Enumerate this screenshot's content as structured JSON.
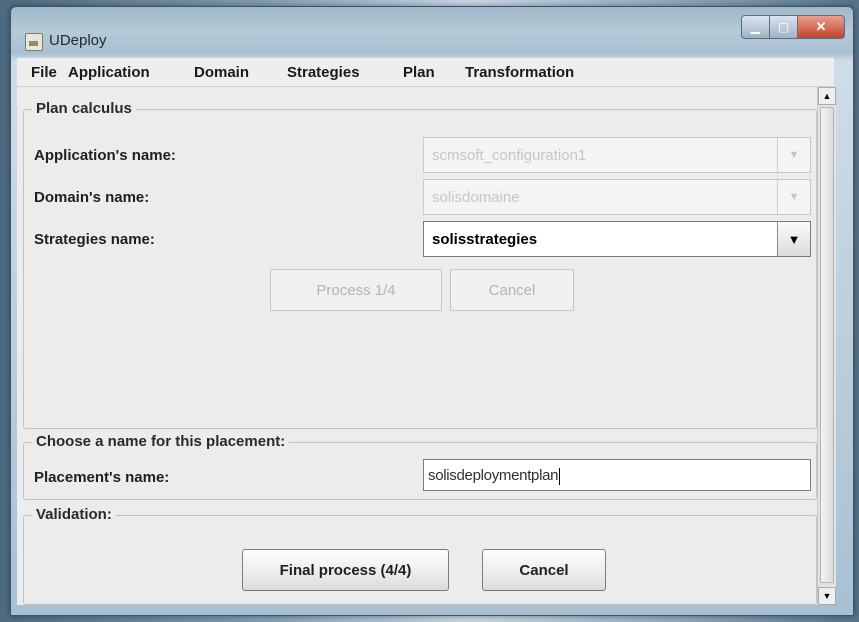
{
  "window": {
    "title": "UDeploy"
  },
  "menu": [
    "File",
    "Application",
    "Domain",
    "Strategies",
    "Plan",
    "Transformation"
  ],
  "plan_calculus": {
    "title": "Plan calculus",
    "application_label": "Application's name:",
    "application_value": "scmsoft_configuration1",
    "domain_label": "Domain's name:",
    "domain_value": "solisdomaine",
    "strategies_label": "Strategies name:",
    "strategies_value": "solisstrategies",
    "process_button": "Process 1/4",
    "cancel_button": "Cancel"
  },
  "placement": {
    "title": "Choose a name for this placement:",
    "label": "Placement's name:",
    "value": "solisdeploymentplan"
  },
  "validation": {
    "title": "Validation:",
    "final_button": "Final process (4/4)",
    "cancel_button": "Cancel"
  }
}
